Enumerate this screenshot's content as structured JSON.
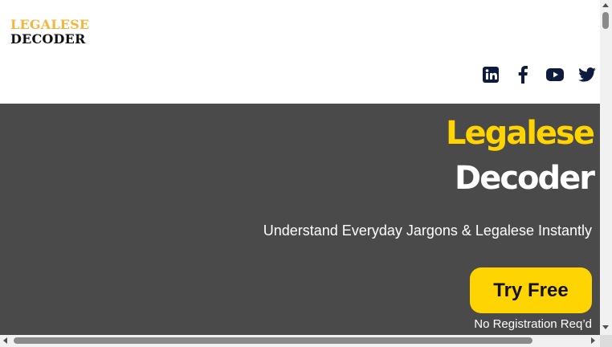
{
  "logo": {
    "line1": "LEGALESE",
    "line2": "DECODER"
  },
  "social": [
    {
      "name": "linkedin-icon"
    },
    {
      "name": "facebook-icon"
    },
    {
      "name": "youtube-icon"
    },
    {
      "name": "twitter-icon"
    }
  ],
  "hero": {
    "title_line1": "Legalese",
    "title_line2": "Decoder",
    "subtitle": "Understand Everyday Jargons & Legalese Instantly",
    "cta_label": "Try Free",
    "cta_note": "No Registration Req’d"
  },
  "colors": {
    "accent": "#ffd400",
    "hero_bg": "#4a4a4a",
    "logo_gold": "#f2b63d",
    "icon": "#0d1b3e"
  }
}
